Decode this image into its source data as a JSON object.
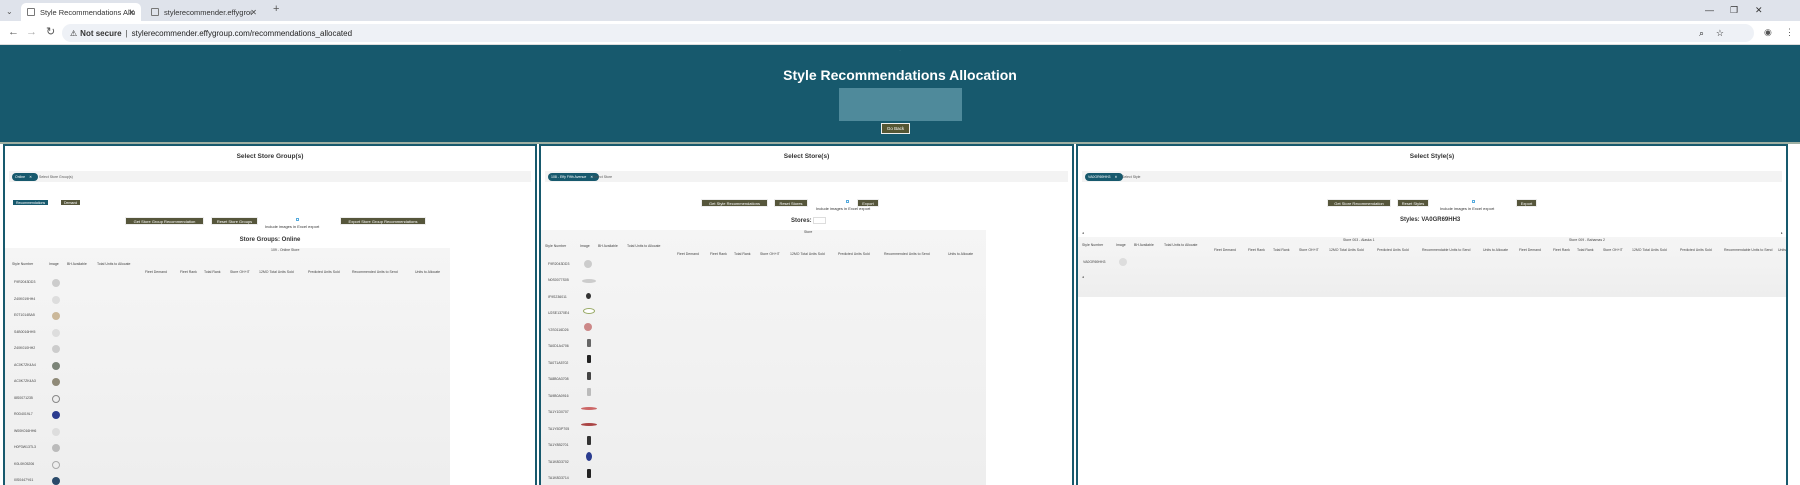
{
  "browser": {
    "tabs": [
      {
        "title": "Style Recommendations Alloca",
        "active": true
      },
      {
        "title": "stylerecommender.effygroup.co",
        "active": false
      }
    ],
    "new_tab": "+",
    "security": "Not secure",
    "url": "stylerecommender.effygroup.com/recommendations_allocated"
  },
  "page": {
    "title": "Style Recommendations Allocation",
    "back_button": "Go Back"
  },
  "store_groups_panel": {
    "title": "Select Store Group(s)",
    "chip": "Online",
    "placeholder": "Select Store Group(s)",
    "toggle_recommendations": "Recommendations",
    "toggle_demand": "Demand",
    "btn_get": "Get Store Group Recommendation",
    "btn_reset": "Reset Store Groups",
    "include_images": "Include images in Excel export",
    "btn_export": "Export Store Group Recommendations",
    "subtitle": "Store Groups: Online",
    "group_header": "109 - Online Store",
    "columns_left": [
      "Style Number",
      "Image",
      "BH Available",
      "Total Units to Allocate"
    ],
    "columns_right": [
      "Fleet Demand",
      "Fleet Rank",
      "Total Rank",
      "Store OH+IT",
      "12MO Total Units Sold",
      "Predicted Units Sold",
      "Recommended Units to Send",
      "Units to Allocate"
    ],
    "rows": [
      "F9R2043DD3",
      "Z40K019HH4",
      "E0T1014BA5",
      "S4B0016HH5",
      "Z40K010HH2",
      "AC0K7ZK4A4",
      "AC0K7ZK4A3",
      "I8S0071235",
      "R0D4019L7",
      "W00K016HH6",
      "H0P3W13TL3",
      "K0L0K05206",
      "I0S0447Y61"
    ]
  },
  "stores_panel": {
    "title": "Select Store(s)",
    "chip": "108 - Effy Fifth Avenue",
    "placeholder": "Select Store",
    "btn_get": "Get Style Recommendations",
    "btn_reset": "Reset Stores",
    "include_images": "Include images in Excel export",
    "btn_export": "Export",
    "subtitle": "Stores:",
    "group_header": "Store",
    "columns_left": [
      "Style Number",
      "Image",
      "BH Available",
      "Total Units to Allocate"
    ],
    "columns_right": [
      "Fleet Demand",
      "Fleet Rank",
      "Total Rank",
      "Store OH+IT",
      "12MO Total Units Sold",
      "Predicted Units Sold",
      "Recommended Units to Send",
      "Units to Allocate"
    ],
    "rows": [
      "F9R2043DD3",
      "N0S0077S05",
      "IF9S236011",
      "U2SE1370E4",
      "Y2S0116D26",
      "TA0D1A4706",
      "TA0T1A5702",
      "TA8B0A3708",
      "TA9B0A0916",
      "TA1Y1D0707",
      "TA1Y5DP705",
      "TA1Y8B2701",
      "TA1K8D3702",
      "TA1K8D3714"
    ]
  },
  "styles_panel": {
    "title": "Select Style(s)",
    "chip": "VA0GR69HH3",
    "placeholder": "Select Style",
    "btn_get": "Get Store Recommendation",
    "btn_reset": "Reset Styles",
    "include_images": "Include images in Excel export",
    "btn_export": "Export",
    "subtitle": "Styles: VA0GR69HH3",
    "store_header_1": "Store 003 - Alaska 1",
    "store_header_2": "Store 009 - Bahamas 2",
    "columns_left": [
      "Style Number",
      "Image",
      "BH Available",
      "Total Units to Allocate"
    ],
    "columns_right": [
      "Fleet Demand",
      "Fleet Rank",
      "Total Rank",
      "Store OH+IT",
      "12MO Total Units Sold",
      "Predicted Units Sold",
      "Recommendable Units to Send",
      "Units to Allocate",
      "Fleet Demand",
      "Fleet Rank",
      "Total Rank",
      "Store OH+IT",
      "12MO Total Units Sold",
      "Predicted Units Sold",
      "Recommendable Units to Send",
      "Units to Se"
    ],
    "rows": [
      "VA0GR69HH3"
    ]
  },
  "colors": {
    "header": "#17596d",
    "button": "#56563b"
  }
}
